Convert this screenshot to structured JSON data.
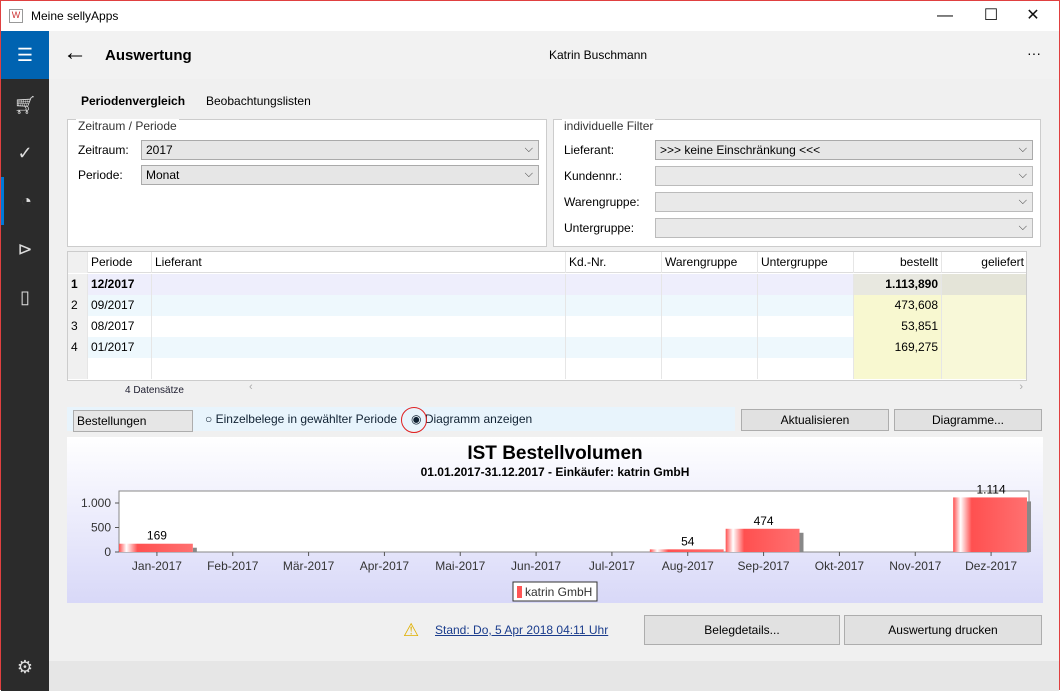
{
  "window": {
    "title": "Meine sellyApps",
    "minimize": "—",
    "maximize": "☐",
    "close": "✕"
  },
  "header": {
    "title": "Auswertung",
    "user": "Katrin Buschmann",
    "more": "···"
  },
  "tabs": [
    {
      "label": "Periodenvergleich",
      "active": true
    },
    {
      "label": "Beobachtungslisten",
      "active": false
    }
  ],
  "period_group": {
    "legend": "Zeitraum / Periode",
    "zeitraum_label": "Zeitraum:",
    "zeitraum_value": "2017",
    "periode_label": "Periode:",
    "periode_value": "Monat"
  },
  "filter_group": {
    "legend": "individuelle Filter",
    "lieferant_label": "Lieferant:",
    "lieferant_value": ">>> keine Einschränkung <<<",
    "kundennr_label": "Kundennr.:",
    "warengruppe_label": "Warengruppe:",
    "untergruppe_label": "Untergruppe:"
  },
  "table": {
    "columns": [
      "Periode",
      "Lieferant",
      "Kd.-Nr.",
      "Warengruppe",
      "Untergruppe",
      "bestellt",
      "geliefert"
    ],
    "rows": [
      {
        "n": "1",
        "periode": "12/2017",
        "bestellt": "1.113,890"
      },
      {
        "n": "2",
        "periode": "09/2017",
        "bestellt": "473,608"
      },
      {
        "n": "3",
        "periode": "08/2017",
        "bestellt": "53,851"
      },
      {
        "n": "4",
        "periode": "01/2017",
        "bestellt": "169,275"
      }
    ],
    "count": "4 Datensätze"
  },
  "controls": {
    "type_value": "Bestellungen",
    "radio1": "Einzelbelege in gewählter Periode",
    "radio2": "Diagramm anzeigen",
    "selected": "radio2",
    "refresh": "Aktualisieren",
    "diagrams": "Diagramme..."
  },
  "chart_data": {
    "type": "bar",
    "title": "IST Bestellvolumen",
    "subtitle": "01.01.2017-31.12.2017 - Einkäufer: katrin GmbH",
    "categories": [
      "Jan-2017",
      "Feb-2017",
      "Mär-2017",
      "Apr-2017",
      "Mai-2017",
      "Jun-2017",
      "Jul-2017",
      "Aug-2017",
      "Sep-2017",
      "Okt-2017",
      "Nov-2017",
      "Dez-2017"
    ],
    "series": [
      {
        "name": "katrin GmbH",
        "values": [
          169,
          0,
          0,
          0,
          0,
          0,
          0,
          54,
          474,
          0,
          0,
          1114
        ],
        "color": "#ff5555"
      }
    ],
    "labels": [
      "169",
      "",
      "",
      "",
      "",
      "",
      "",
      "54",
      "474",
      "",
      "",
      "1.114"
    ],
    "yticks": [
      "0",
      "500",
      "1.000"
    ],
    "ytick_values": [
      0,
      500,
      1000
    ],
    "ylim": [
      0,
      1245
    ],
    "legend": "bottom"
  },
  "footer": {
    "stand": "Stand: Do, 5 Apr 2018 04:11 Uhr",
    "belegdetails": "Belegdetails...",
    "drucken": "Auswertung drucken"
  }
}
